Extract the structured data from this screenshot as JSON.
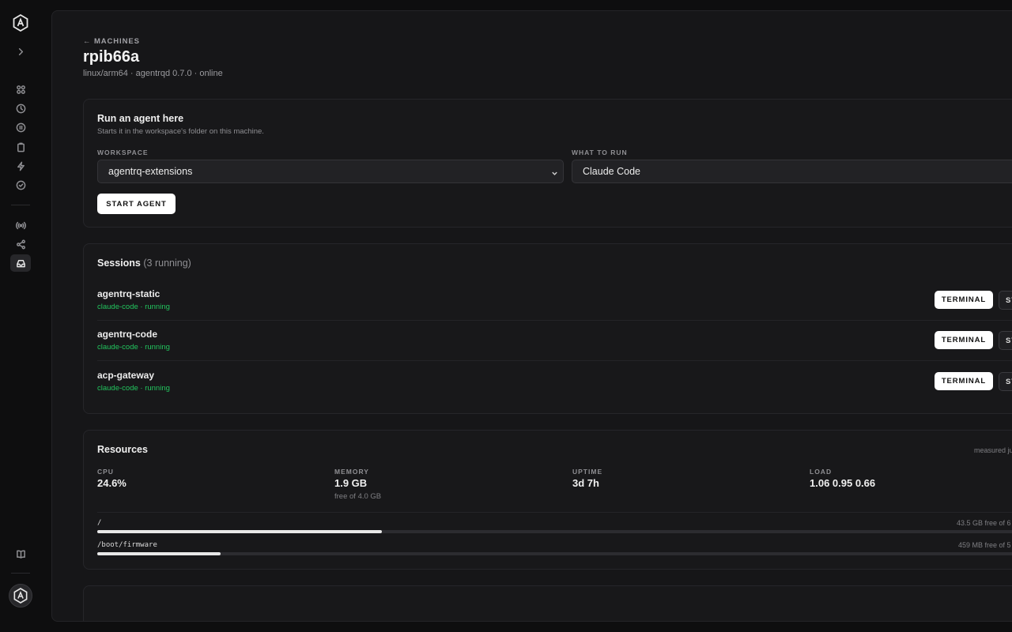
{
  "header": {
    "back_label": "← MACHINES",
    "title": "rpib66a",
    "subtitle": "linux/arm64 · agentrqd 0.7.0 · online"
  },
  "run_agent": {
    "title": "Run an agent here",
    "subtitle": "Starts it in the workspace's folder on this machine.",
    "workspace_label": "WORKSPACE",
    "workspace_value": "agentrq-extensions",
    "what_label": "WHAT TO RUN",
    "what_value": "Claude Code",
    "start_button": "START AGENT"
  },
  "sessions": {
    "title": "Sessions",
    "count_text": "(3 running)",
    "terminal_label": "TERMINAL",
    "stop_label": "ST",
    "items": [
      {
        "name": "agentrq-static",
        "status": "claude-code · running"
      },
      {
        "name": "agentrq-code",
        "status": "claude-code · running"
      },
      {
        "name": "acp-gateway",
        "status": "claude-code · running"
      }
    ]
  },
  "resources": {
    "title": "Resources",
    "measured": "measured ju",
    "stats": [
      {
        "label": "CPU",
        "value": "24.6%",
        "note": ""
      },
      {
        "label": "MEMORY",
        "value": "1.9 GB",
        "note": "free of 4.0 GB"
      },
      {
        "label": "UPTIME",
        "value": "3d 7h",
        "note": ""
      },
      {
        "label": "LOAD",
        "value": "1.06 0.95 0.66",
        "note": ""
      }
    ],
    "mounts": [
      {
        "path": "/",
        "free": "43.5 GB free of 6",
        "used_fraction": 0.3
      },
      {
        "path": "/boot/firmware",
        "free": "459 MB free of 5",
        "used_fraction": 0.13
      }
    ]
  },
  "sidebar": {
    "icons": [
      "logo-icon",
      "expand-chevron-icon",
      "grid-icon",
      "clock-icon",
      "pause-circle-icon",
      "clipboard-icon",
      "bolt-icon",
      "check-circle-icon",
      "broadcast-icon",
      "share-icon",
      "inbox-icon",
      "book-icon",
      "avatar-logo-icon"
    ]
  }
}
